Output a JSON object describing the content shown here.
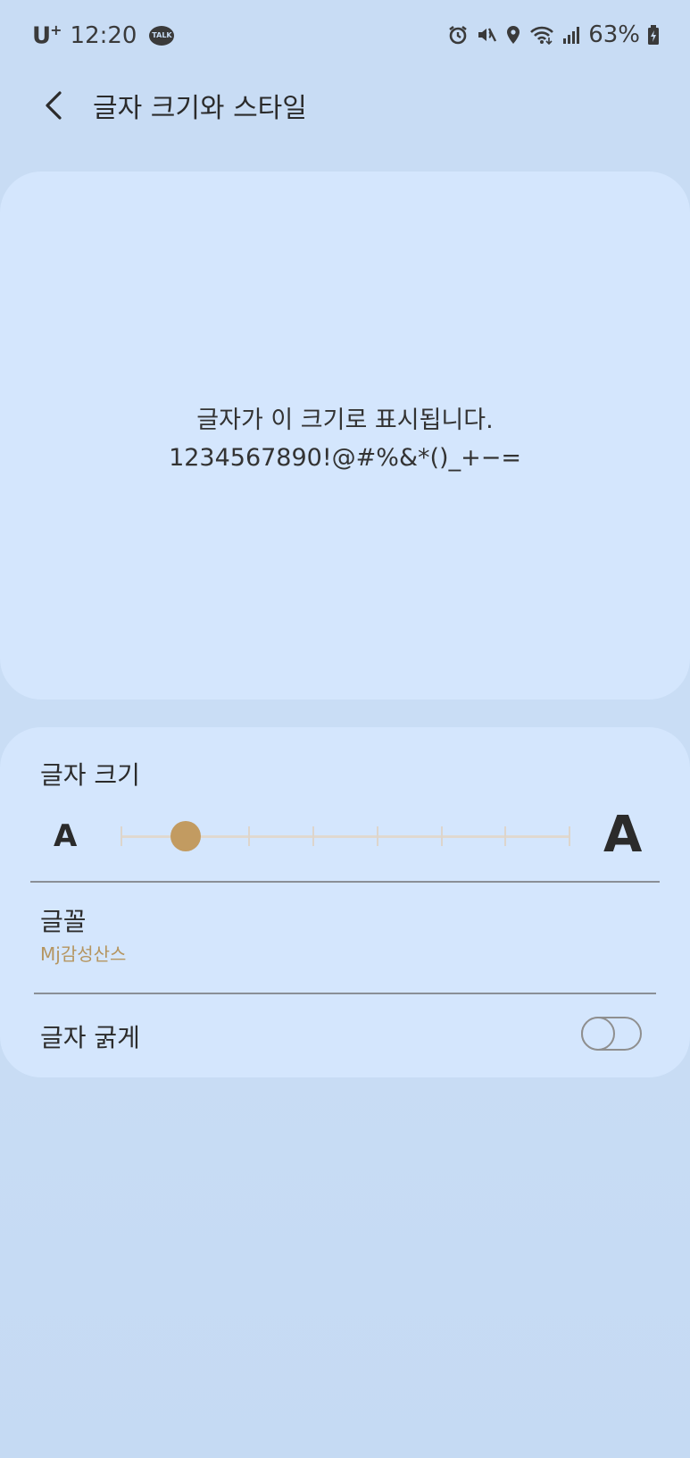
{
  "status_bar": {
    "carrier": "U",
    "carrier_plus": "+",
    "time": "12:20",
    "talk_label": "TALK",
    "battery_percent": "63%"
  },
  "header": {
    "title": "글자 크기와 스타일"
  },
  "preview": {
    "line1": "글자가 이 크기로 표시됩니다.",
    "line2": "1234567890!@#%&*()_+−="
  },
  "font_size": {
    "label": "글자 크기",
    "small_glyph": "A",
    "large_glyph": "A",
    "level": 2,
    "levels": 8
  },
  "font": {
    "label": "글꼴",
    "value": "Mj감성산스"
  },
  "bold_text": {
    "label": "글자 굵게",
    "enabled": false
  },
  "colors": {
    "accent": "#c29b61",
    "card_background": "#d4e6fd",
    "page_background": "#c8dcf4"
  }
}
